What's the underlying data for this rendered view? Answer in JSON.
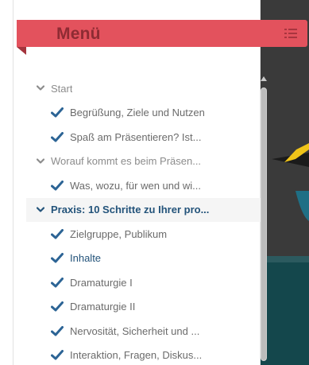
{
  "menu": {
    "title": "Menü",
    "toggle_icon": "list-icon",
    "colors": {
      "ribbon": "#e3525d",
      "ribbon_text": "#8e2b33",
      "active": "#23537a",
      "check": "#2c6495",
      "muted": "#8c8c8c"
    },
    "items": [
      {
        "type": "section",
        "label": "Start",
        "icon": "chevron-down-icon",
        "active": false
      },
      {
        "type": "child",
        "label": "Begrüßung, Ziele und Nutzen",
        "icon": "check-icon",
        "active": false
      },
      {
        "type": "child",
        "label": "Spaß am Präsentieren? Ist...",
        "icon": "check-icon",
        "active": false
      },
      {
        "type": "section",
        "label": "Worauf kommt es beim Präsen...",
        "icon": "chevron-down-icon",
        "active": false
      },
      {
        "type": "child",
        "label": "Was, wozu, für wen und wi...",
        "icon": "check-icon",
        "active": false
      },
      {
        "type": "section",
        "label": "Praxis: 10 Schritte zu Ihrer pro...",
        "icon": "chevron-down-icon",
        "active": true
      },
      {
        "type": "child",
        "label": "Zielgruppe, Publikum",
        "icon": "check-icon",
        "active": false
      },
      {
        "type": "child",
        "label": "Inhalte",
        "icon": "check-icon",
        "active": true
      },
      {
        "type": "child",
        "label": "Dramaturgie I",
        "icon": "check-icon",
        "active": false
      },
      {
        "type": "child",
        "label": "Dramaturgie II",
        "icon": "check-icon",
        "active": false
      },
      {
        "type": "child",
        "label": "Nervosität, Sicherheit und ...",
        "icon": "check-icon",
        "active": false
      },
      {
        "type": "child",
        "label": "Interaktion, Fragen, Diskus...",
        "icon": "check-icon",
        "active": false
      }
    ]
  }
}
